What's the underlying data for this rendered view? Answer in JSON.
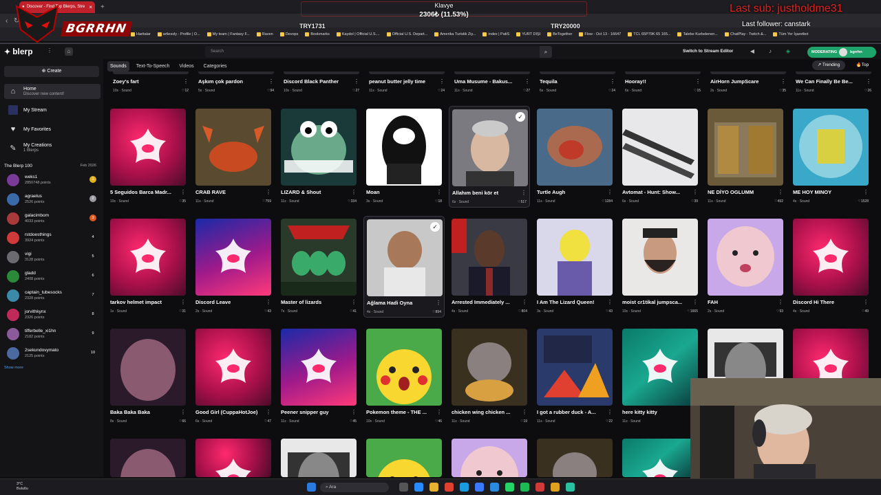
{
  "browser": {
    "tab_title": "Discover - Find Top Blerps, Stre",
    "new_tab": "+",
    "bookmarks": [
      "Haritalar",
      "artlessly - Profile | O...",
      "My team | Fantasy F...",
      "Raven",
      "Devops",
      "Bookmarks",
      "Kaydol | Official U.S....",
      "Official U.S. Depart...",
      "Amerika Turistik Ziy...",
      "index | PatiS",
      "YURT DIŞI",
      "BeTogether",
      "Flow - Oct 13 - 16647",
      "TCL 65P79K 65 165...",
      "Talebe Kurbelenen...",
      "ChatPlay - Twitch &...",
      "Tüm Yer İşaretleri"
    ]
  },
  "overlay": {
    "bar_title": "Klavye",
    "bar_value": "2306₺ (11.53%)",
    "left_label": "TRY1731",
    "right_label": "TRY20000",
    "last_sub": "Last sub: justholdme31",
    "last_follower": "Last follower: canstark",
    "logo_text": "BGRRHN"
  },
  "header": {
    "brand": "blerp",
    "search_placeholder": "Search",
    "switch_label": "Switch to Stream Editor",
    "mod_label": "MODERATING",
    "mod_user": "bgrrhn"
  },
  "sidebar": {
    "create": "Create",
    "nav": [
      {
        "label": "Home",
        "sub": "Discover new content!"
      },
      {
        "label": "My Stream",
        "sub": ""
      },
      {
        "label": "My Favorites",
        "sub": ""
      },
      {
        "label": "My Creations",
        "sub": "1 Blerps"
      }
    ],
    "top100_title": "The Blerp 100",
    "top100_date": "Feb 2026",
    "leaders": [
      {
        "name": "weks1",
        "points": "2850748 points",
        "rank": "1",
        "color": "#e0b020",
        "av": "#7a3a9a"
      },
      {
        "name": "agraelus",
        "points": "2526 points",
        "rank": "2",
        "color": "#9a9aa0",
        "av": "#3a6aa8"
      },
      {
        "name": "galacimbom",
        "points": "4033 points",
        "rank": "3",
        "color": "#e05a20",
        "av": "#a83a3a"
      },
      {
        "name": "rstdoesthings",
        "points": "3924 points",
        "rank": "4",
        "color": "",
        "av": "#d03a3a"
      },
      {
        "name": "vigi",
        "points": "3128 points",
        "rank": "5",
        "color": "",
        "av": "#6a6a70"
      },
      {
        "name": "gladd",
        "points": "2408 points",
        "rank": "6",
        "color": "",
        "av": "#2a8a3a"
      },
      {
        "name": "captain_tubesocks",
        "points": "2328 points",
        "rank": "7",
        "color": "",
        "av": "#3a8aa8"
      },
      {
        "name": "jorvithkynx",
        "points": "2326 points",
        "rank": "8",
        "color": "",
        "av": "#c02a5a"
      },
      {
        "name": "tifferbelle_xi1hn",
        "points": "2182 points",
        "rank": "9",
        "color": "",
        "av": "#8a5a9a"
      },
      {
        "name": "2sekundovymato",
        "points": "2125 points",
        "rank": "10",
        "color": "",
        "av": "#4a6aa0"
      }
    ],
    "show_more": "Show more"
  },
  "main": {
    "tabs": [
      "Sounds",
      "Text-To-Speech",
      "Videos",
      "Categories"
    ],
    "trending": "Trending",
    "top": "Top",
    "top_row": [
      {
        "title": "Zoey's fart",
        "meta": "10s · Sound",
        "likes": "12"
      },
      {
        "title": "Aşkım çok pardon",
        "meta": "5s · Sound",
        "likes": "94"
      },
      {
        "title": "Discord Black Panther",
        "meta": "10s · Sound",
        "likes": "27"
      },
      {
        "title": "peanut butter jelly time",
        "meta": "11s · Sound",
        "likes": "24"
      },
      {
        "title": "Uma Musume - Bakus...",
        "meta": "11s · Sound",
        "likes": "27"
      },
      {
        "title": "Tequila",
        "meta": "6s · Sound",
        "likes": "24"
      },
      {
        "title": "Hooray!!",
        "meta": "6s · Sound",
        "likes": "15"
      },
      {
        "title": "AirHorn JumpScare",
        "meta": "2s · Sound",
        "likes": "35"
      },
      {
        "title": "We Can Finally Be Be...",
        "meta": "11s · Sound",
        "likes": "26"
      }
    ],
    "rows": [
      [
        {
          "title": "5 Seguidos Barca Madr...",
          "meta": "10s · Sound",
          "likes": "35",
          "th": "ph"
        },
        {
          "title": "CRAB RAVE",
          "meta": "11s · Sound",
          "likes": "759",
          "th": "crab"
        },
        {
          "title": "LIZARD & Shout",
          "meta": "11s · Sound",
          "likes": "334",
          "th": "frog"
        },
        {
          "title": "Moan",
          "meta": "3s · Sound",
          "likes": "18",
          "th": "moan"
        },
        {
          "title": "Allahım beni kör et",
          "meta": "6s · Sound",
          "likes": "517",
          "th": "man",
          "sel": true
        },
        {
          "title": "Turtle Augh",
          "meta": "11s · Sound",
          "likes": "1284",
          "th": "turtle"
        },
        {
          "title": "Avtomat - Hunt: Show...",
          "meta": "6s · Sound",
          "likes": "39",
          "th": "gun"
        },
        {
          "title": "NE DİYO OGLUMM",
          "meta": "11s · Sound",
          "likes": "492",
          "th": "store"
        },
        {
          "title": "ME HOY MINOY",
          "meta": "4s · Sound",
          "likes": "1528",
          "th": "sponge"
        }
      ],
      [
        {
          "title": "tarkov helmet impact",
          "meta": "1s · Sound",
          "likes": "31",
          "th": "ph"
        },
        {
          "title": "Discord Leave",
          "meta": "2s · Sound",
          "likes": "43",
          "th": "ph2"
        },
        {
          "title": "Master of lizards",
          "meta": "7s · Sound",
          "likes": "41",
          "th": "metal"
        },
        {
          "title": "Ağlama Hadi Oyna",
          "meta": "4s · Sound",
          "likes": "894",
          "th": "laugh",
          "sel": true
        },
        {
          "title": "Arrested Immediately ...",
          "meta": "4s · Sound",
          "likes": "804",
          "th": "suit"
        },
        {
          "title": "I Am The Lizard Queen!",
          "meta": "3s · Sound",
          "likes": "43",
          "th": "simp"
        },
        {
          "title": "moist cr1tikal jumpsca...",
          "meta": "10s · Sound",
          "likes": "1665",
          "th": "moist"
        },
        {
          "title": "FAH",
          "meta": "2s · Sound",
          "likes": "93",
          "th": "baby"
        },
        {
          "title": "Discord Hi There",
          "meta": "4s · Sound",
          "likes": "49",
          "th": "ph"
        }
      ],
      [
        {
          "title": "Baka Baka Baka",
          "meta": "8s · Sound",
          "likes": "66",
          "th": "baka"
        },
        {
          "title": "Good Girl (CuppaHotJoe)",
          "meta": "6s · Sound",
          "likes": "47",
          "th": "ph"
        },
        {
          "title": "Peener snipper guy",
          "meta": "11s · Sound",
          "likes": "45",
          "th": "ph2"
        },
        {
          "title": "Pokemon theme - THE ...",
          "meta": "10s · Sound",
          "likes": "46",
          "th": "pika"
        },
        {
          "title": "chicken wing chicken ...",
          "meta": "11s · Sound",
          "likes": "19",
          "th": "hippo"
        },
        {
          "title": "I got a rubber duck - A...",
          "meta": "11s · Sound",
          "likes": "22",
          "th": "arc"
        },
        {
          "title": "here kitty kitty",
          "meta": "11s · Sound",
          "likes": "",
          "th": "ph3"
        },
        {
          "title": "",
          "meta": "",
          "likes": "",
          "th": "bw"
        },
        {
          "title": "",
          "meta": "",
          "likes": "",
          "th": "ph"
        }
      ]
    ]
  },
  "taskbar": {
    "temp": "3°C",
    "weather": "Bulutlu",
    "search": "Ara"
  },
  "colors": {
    "accent": "#1ea36a",
    "brand_pink": "#ff2a6e",
    "overlay_red": "#e02020"
  }
}
